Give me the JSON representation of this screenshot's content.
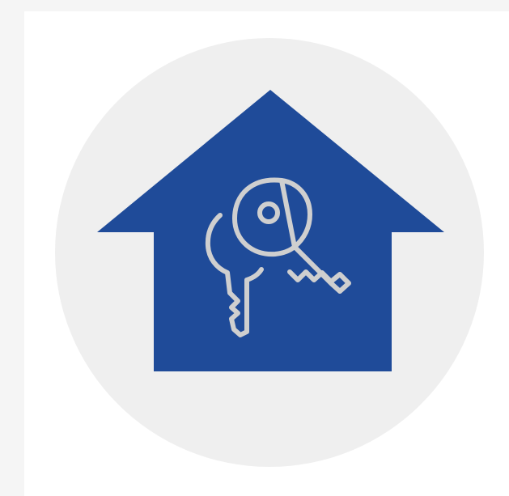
{
  "image": {
    "icon_name": "house-with-keys-icon",
    "colors": {
      "page_background": "#f5f5f5",
      "panel_background": "#ffffff",
      "circle_background": "#efefef",
      "house_fill": "#1f4b99",
      "key_stroke": "#cfcfcf"
    }
  }
}
